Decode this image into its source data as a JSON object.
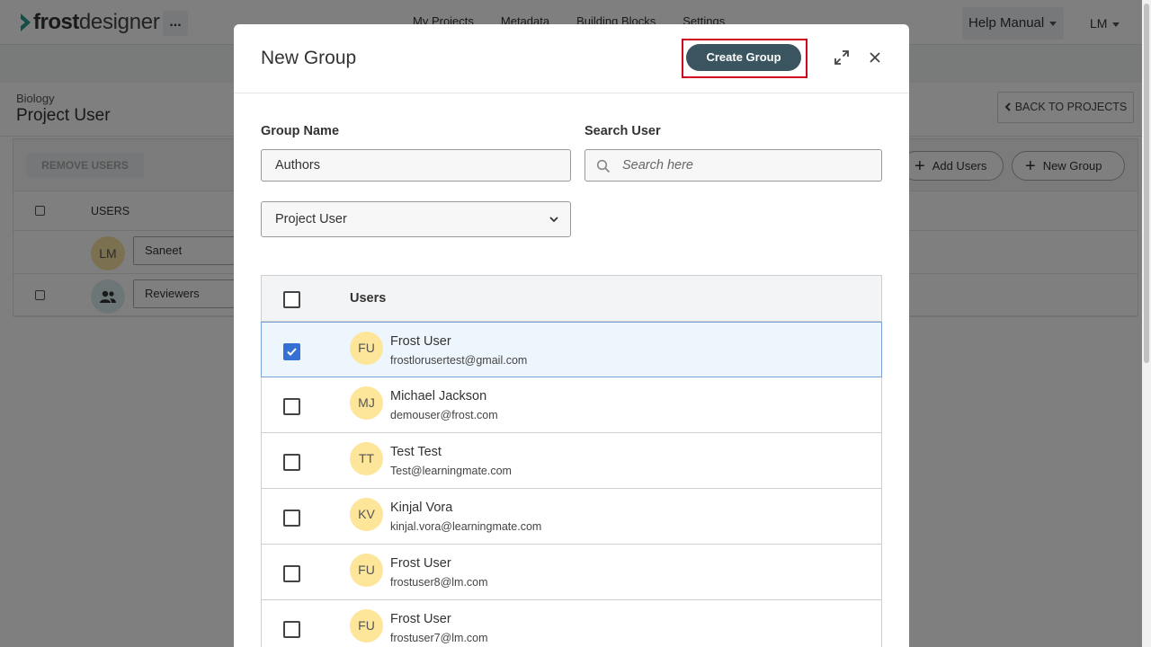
{
  "app": {
    "logo_bold": "frost",
    "logo_light": "designer",
    "more_label": "...",
    "nav": [
      "My Projects",
      "Metadata",
      "Building Blocks",
      "Settings"
    ],
    "help_label": "Help Manual",
    "user_initials": "LM"
  },
  "page": {
    "breadcrumb_sub": "Biology",
    "title": "Project User",
    "back_label": "BACK TO PROJECTS",
    "remove_users_label": "REMOVE USERS",
    "add_users_label": "Add Users",
    "new_group_label": "New Group",
    "users_header": "USERS",
    "rows": [
      {
        "avatar": "LM",
        "name": "Saneet"
      },
      {
        "avatar": "",
        "name": "Reviewers"
      }
    ]
  },
  "modal": {
    "title": "New Group",
    "create_label": "Create Group",
    "group_name_label": "Group Name",
    "group_name_value": "Authors",
    "search_label": "Search User",
    "search_placeholder": "Search here",
    "role_value": "Project User",
    "table_header": "Users",
    "users": [
      {
        "initials": "FU",
        "name": "Frost User",
        "email": "frostlorusertest@gmail.com",
        "checked": true
      },
      {
        "initials": "MJ",
        "name": "Michael Jackson",
        "email": "demouser@frost.com",
        "checked": false
      },
      {
        "initials": "TT",
        "name": "Test Test",
        "email": "Test@learningmate.com",
        "checked": false
      },
      {
        "initials": "KV",
        "name": "Kinjal Vora",
        "email": "kinjal.vora@learningmate.com",
        "checked": false
      },
      {
        "initials": "FU",
        "name": "Frost User",
        "email": "frostuser8@lm.com",
        "checked": false
      },
      {
        "initials": "FU",
        "name": "Frost User",
        "email": "frostuser7@lm.com",
        "checked": false
      }
    ]
  },
  "colors": {
    "primary_button": "#3b5560",
    "highlight": "#d0021b",
    "checkbox_checked": "#3571d4",
    "avatar_bg": "#fde59a"
  }
}
